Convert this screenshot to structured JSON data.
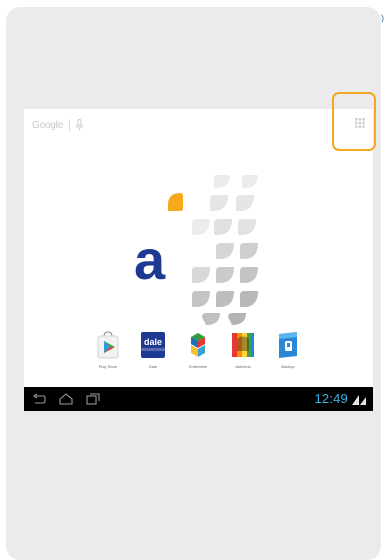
{
  "home": {
    "search_label": "Google",
    "dock": [
      {
        "label": "Play Store",
        "icon": "play-store-icon"
      },
      {
        "label": "Dale",
        "icon": "dale-app-icon"
      },
      {
        "label": "Entertaine",
        "icon": "entertainment-app-icon"
      },
      {
        "label": "Antivirus",
        "icon": "antivirus-app-icon"
      },
      {
        "label": "Backup",
        "icon": "backup-app-icon"
      }
    ],
    "dale_icon_text": "dale"
  },
  "status_bar": {
    "time": "12:49"
  },
  "colors": {
    "accent_orange": "#f2a81f",
    "clock_blue": "#33b5e5",
    "brand_navy": "#1f3a93"
  }
}
